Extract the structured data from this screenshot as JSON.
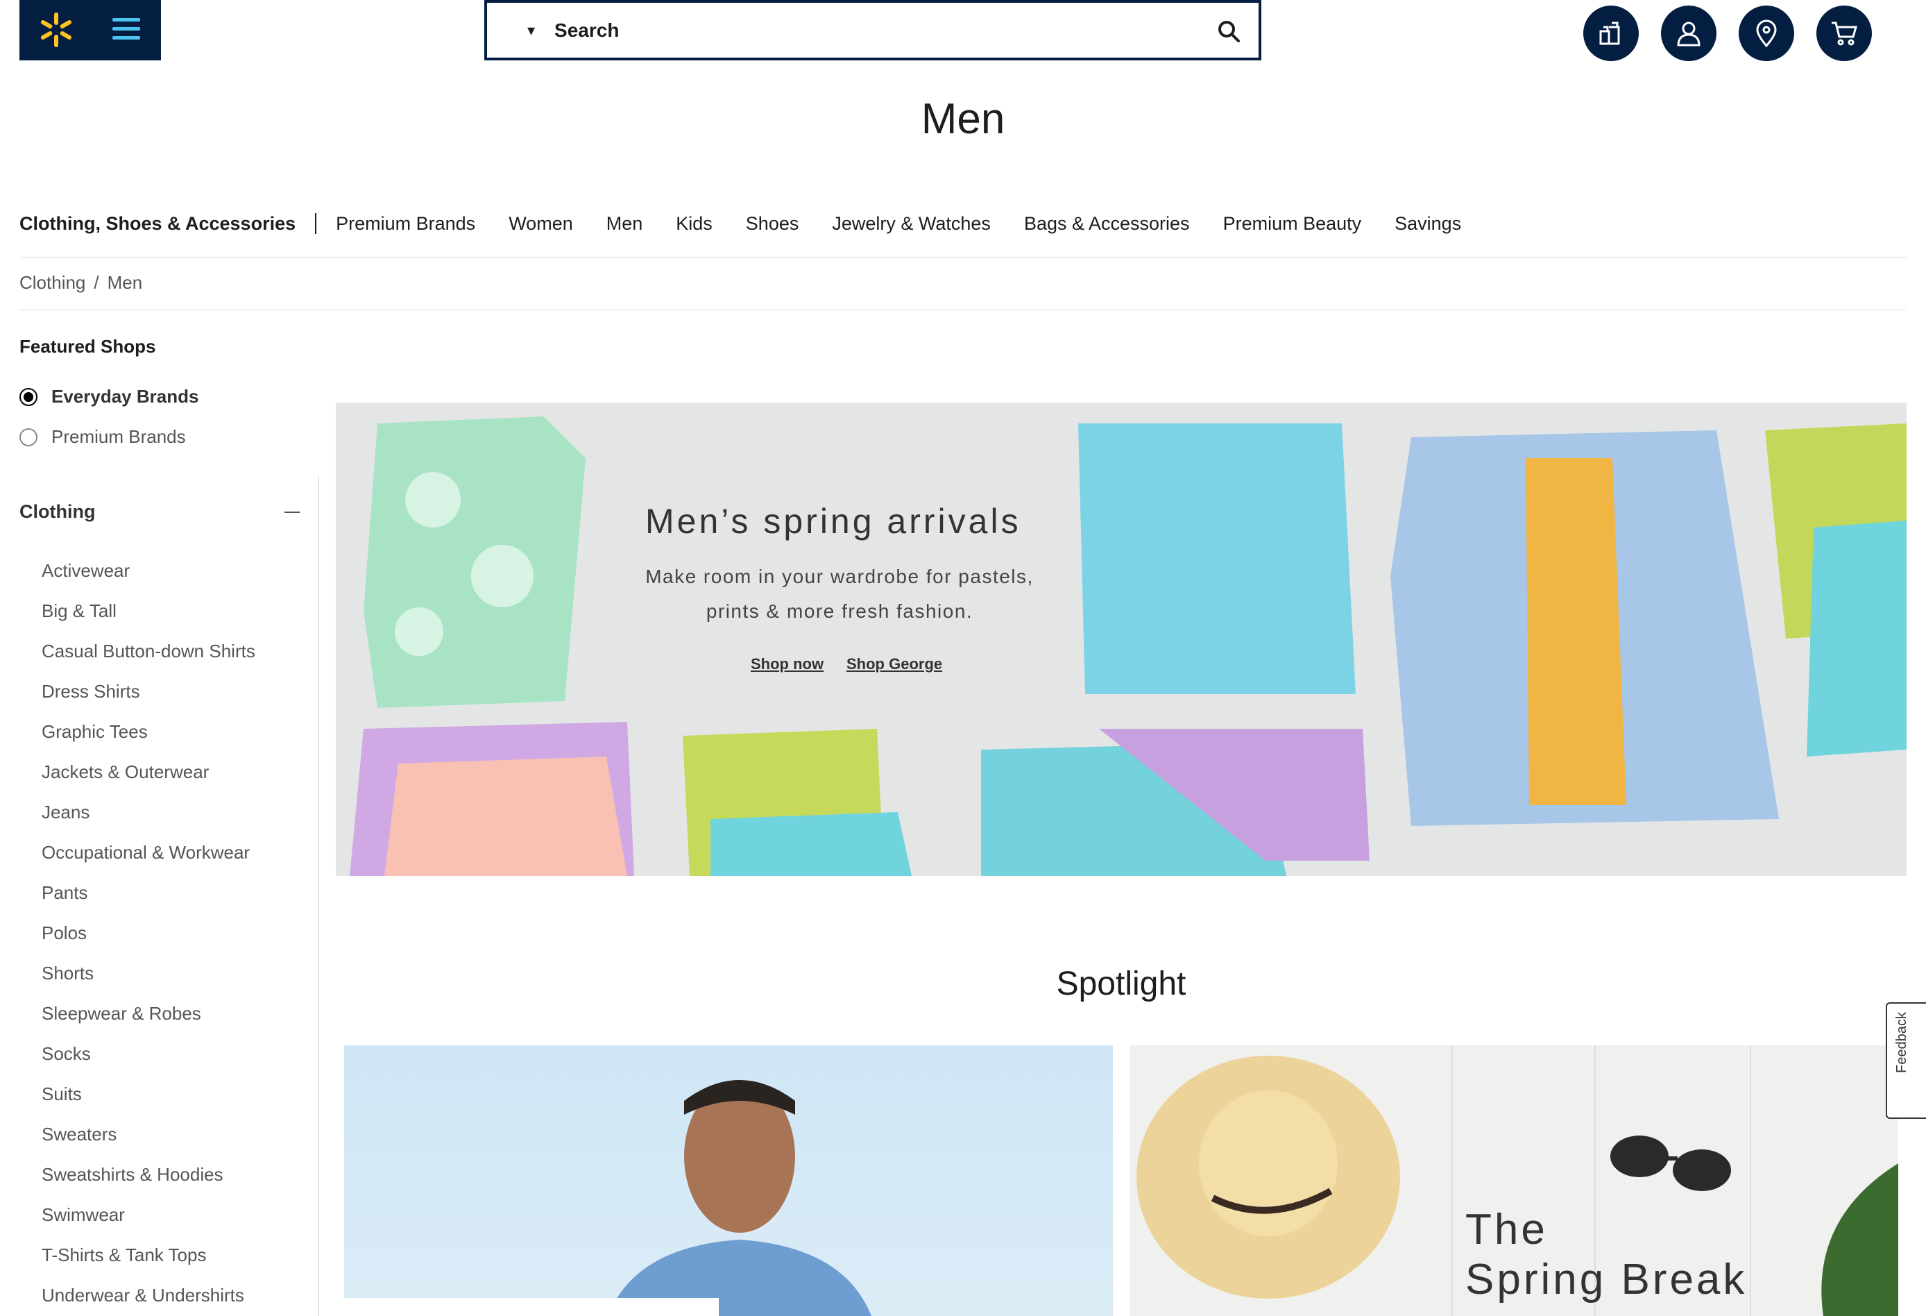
{
  "header": {
    "logo_icon": "walmart-spark-icon",
    "menu_icon": "hamburger-icon",
    "search": {
      "placeholder": "Search",
      "dropdown_icon": "caret-down-icon",
      "submit_icon": "search-icon"
    },
    "buttons": [
      {
        "name": "reorder-button",
        "icon": "reorder-icon"
      },
      {
        "name": "account-button",
        "icon": "user-icon"
      },
      {
        "name": "store-locator-button",
        "icon": "location-pin-icon"
      },
      {
        "name": "cart-button",
        "icon": "cart-icon"
      }
    ],
    "brand_color": "#041e42",
    "spark_color": "#ffc220"
  },
  "page_title": "Men",
  "category_nav": {
    "current": "Clothing, Shoes & Accessories",
    "items": [
      "Premium Brands",
      "Women",
      "Men",
      "Kids",
      "Shoes",
      "Jewelry & Watches",
      "Bags & Accessories",
      "Premium Beauty",
      "Savings"
    ]
  },
  "breadcrumb": {
    "items": [
      "Clothing",
      "Men"
    ],
    "separator": "/"
  },
  "featured_shops": {
    "title": "Featured Shops",
    "options": [
      {
        "label": "Everyday Brands",
        "selected": true
      },
      {
        "label": "Premium Brands",
        "selected": false
      }
    ]
  },
  "clothing_section": {
    "title": "Clothing",
    "expanded": true,
    "items": [
      "Activewear",
      "Big & Tall",
      "Casual Button-down Shirts",
      "Dress Shirts",
      "Graphic Tees",
      "Jackets & Outerwear",
      "Jeans",
      "Occupational & Workwear",
      "Pants",
      "Polos",
      "Shorts",
      "Sleepwear & Robes",
      "Socks",
      "Suits",
      "Sweaters",
      "Sweatshirts & Hoodies",
      "Swimwear",
      "T-Shirts & Tank Tops",
      "Underwear & Undershirts"
    ]
  },
  "hero": {
    "title": "Men’s spring arrivals",
    "subtitle": "Make room in your wardrobe for pastels, prints & more fresh fashion.",
    "links": [
      "Shop now",
      "Shop George"
    ]
  },
  "spotlight": {
    "title": "Spotlight",
    "card2_text": [
      "The",
      "Spring Break"
    ]
  },
  "feedback_label": "Feedback"
}
